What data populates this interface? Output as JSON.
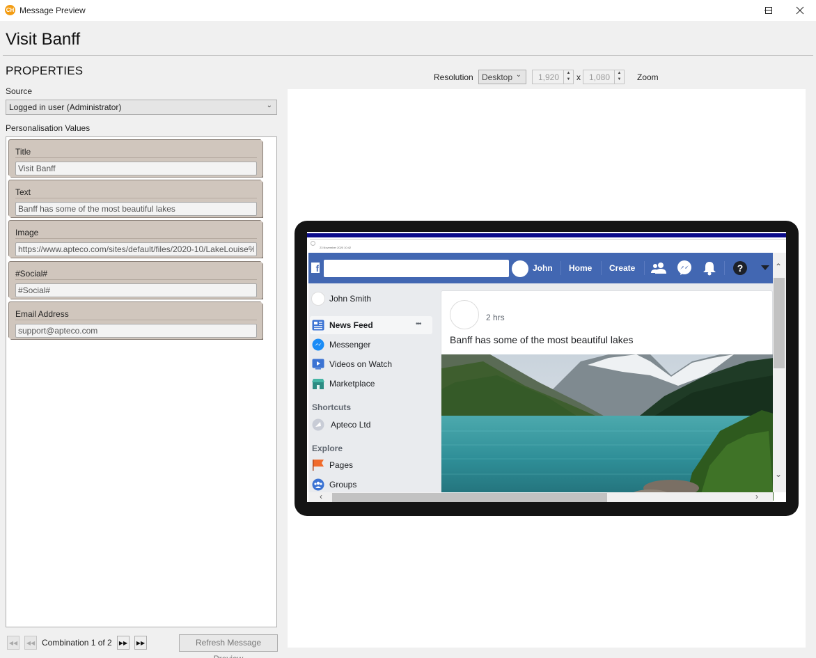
{
  "window": {
    "title": "Message Preview",
    "app_icon_text": "CH",
    "controls": [
      "minimize-icon",
      "maximize-icon",
      "close-icon"
    ]
  },
  "header": {
    "title": "Visit Banff"
  },
  "properties": {
    "heading": "PROPERTIES",
    "source_label": "Source",
    "source_value": "Logged in user (Administrator)",
    "personalisation_label": "Personalisation Values",
    "fields": [
      {
        "label": "Title",
        "value": "Visit Banff"
      },
      {
        "label": "Text",
        "value": "Banff has some of the most beautiful lakes"
      },
      {
        "label": "Image",
        "value": "https://www.apteco.com/sites/default/files/2020-10/LakeLouise%"
      },
      {
        "label": "#Social#",
        "value": "#Social#"
      },
      {
        "label": "Email Address",
        "value": "support@apteco.com"
      }
    ]
  },
  "footer": {
    "combination_text": "Combination 1 of 2",
    "refresh_label": "Refresh Message Preview",
    "nav_icons": [
      "first-icon",
      "previous-icon",
      "next-icon",
      "last-icon"
    ]
  },
  "resolution": {
    "label": "Resolution",
    "device": "Desktop",
    "width": "1,920",
    "times": "x",
    "height": "1,080",
    "zoom_label": "Zoom"
  },
  "preview": {
    "email_date": "23 November 2020 10:42",
    "fb": {
      "user_short": "John",
      "nav_home": "Home",
      "nav_create": "Create",
      "sidebar": {
        "profile_name": "John Smith",
        "items": [
          {
            "label": "News Feed",
            "icon": "news-feed-icon"
          },
          {
            "label": "Messenger",
            "icon": "messenger-icon"
          },
          {
            "label": "Videos on Watch",
            "icon": "watch-icon"
          },
          {
            "label": "Marketplace",
            "icon": "marketplace-icon"
          }
        ],
        "more_glyph": "•••",
        "shortcuts_heading": "Shortcuts",
        "shortcut": "Apteco Ltd",
        "explore_heading": "Explore",
        "explore_items": [
          {
            "label": "Pages",
            "icon": "flag-icon"
          },
          {
            "label": "Groups",
            "icon": "groups-icon"
          }
        ]
      },
      "post": {
        "time": "2 hrs",
        "text": "Banff has some of the most beautiful lakes",
        "image_alt": "lake-photo"
      }
    }
  },
  "colors": {
    "facebook_blue": "#4267b2",
    "card_bg": "#d0c6bd",
    "device_frame": "#141414",
    "app_icon": "#f39c12"
  }
}
